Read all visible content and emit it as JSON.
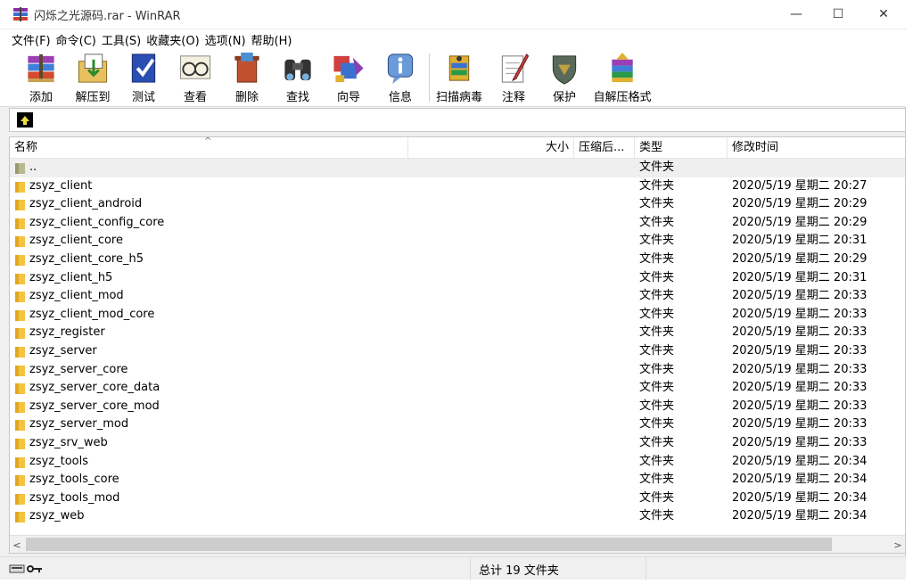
{
  "window": {
    "title": "闪烁之光源码.rar - WinRAR",
    "minimize_glyph": "—",
    "maximize_glyph": "☐",
    "close_glyph": "✕"
  },
  "menu": [
    {
      "label": "文件(F)"
    },
    {
      "label": "命令(C)"
    },
    {
      "label": "工具(S)"
    },
    {
      "label": "收藏夹(O)"
    },
    {
      "label": "选项(N)"
    },
    {
      "label": "帮助(H)"
    }
  ],
  "toolbar": [
    {
      "label": "添加",
      "icon": "add-icon"
    },
    {
      "label": "解压到",
      "icon": "extract-to-icon"
    },
    {
      "label": "测试",
      "icon": "test-icon"
    },
    {
      "label": "查看",
      "icon": "view-icon"
    },
    {
      "label": "删除",
      "icon": "delete-icon"
    },
    {
      "label": "查找",
      "icon": "find-icon"
    },
    {
      "label": "向导",
      "icon": "wizard-icon"
    },
    {
      "label": "信息",
      "icon": "info-icon"
    },
    {
      "label": "扫描病毒",
      "icon": "virus-scan-icon"
    },
    {
      "label": "注释",
      "icon": "comment-icon"
    },
    {
      "label": "保护",
      "icon": "protect-icon"
    },
    {
      "label": "自解压格式",
      "icon": "sfx-icon"
    }
  ],
  "columns": {
    "name": "名称",
    "size": "大小",
    "packed": "压缩后...",
    "type": "类型",
    "modified": "修改时间",
    "sort_arrow": "^"
  },
  "rows": [
    {
      "name": "..",
      "type": "文件夹",
      "modified": ""
    },
    {
      "name": "zsyz_client",
      "type": "文件夹",
      "modified": "2020/5/19 星期二 20:27"
    },
    {
      "name": "zsyz_client_android",
      "type": "文件夹",
      "modified": "2020/5/19 星期二 20:29"
    },
    {
      "name": "zsyz_client_config_core",
      "type": "文件夹",
      "modified": "2020/5/19 星期二 20:29"
    },
    {
      "name": "zsyz_client_core",
      "type": "文件夹",
      "modified": "2020/5/19 星期二 20:31"
    },
    {
      "name": "zsyz_client_core_h5",
      "type": "文件夹",
      "modified": "2020/5/19 星期二 20:29"
    },
    {
      "name": "zsyz_client_h5",
      "type": "文件夹",
      "modified": "2020/5/19 星期二 20:31"
    },
    {
      "name": "zsyz_client_mod",
      "type": "文件夹",
      "modified": "2020/5/19 星期二 20:33"
    },
    {
      "name": "zsyz_client_mod_core",
      "type": "文件夹",
      "modified": "2020/5/19 星期二 20:33"
    },
    {
      "name": "zsyz_register",
      "type": "文件夹",
      "modified": "2020/5/19 星期二 20:33"
    },
    {
      "name": "zsyz_server",
      "type": "文件夹",
      "modified": "2020/5/19 星期二 20:33"
    },
    {
      "name": "zsyz_server_core",
      "type": "文件夹",
      "modified": "2020/5/19 星期二 20:33"
    },
    {
      "name": "zsyz_server_core_data",
      "type": "文件夹",
      "modified": "2020/5/19 星期二 20:33"
    },
    {
      "name": "zsyz_server_core_mod",
      "type": "文件夹",
      "modified": "2020/5/19 星期二 20:33"
    },
    {
      "name": "zsyz_server_mod",
      "type": "文件夹",
      "modified": "2020/5/19 星期二 20:33"
    },
    {
      "name": "zsyz_srv_web",
      "type": "文件夹",
      "modified": "2020/5/19 星期二 20:33"
    },
    {
      "name": "zsyz_tools",
      "type": "文件夹",
      "modified": "2020/5/19 星期二 20:34"
    },
    {
      "name": "zsyz_tools_core",
      "type": "文件夹",
      "modified": "2020/5/19 星期二 20:34"
    },
    {
      "name": "zsyz_tools_mod",
      "type": "文件夹",
      "modified": "2020/5/19 星期二 20:34"
    },
    {
      "name": "zsyz_web",
      "type": "文件夹",
      "modified": "2020/5/19 星期二 20:34"
    }
  ],
  "status": {
    "summary": "总计 19 文件夹"
  },
  "scrollbar": {
    "left_glyph": "<",
    "right_glyph": ">"
  },
  "colors": {
    "folder": "#f5c242",
    "parent_folder": "#b8b890"
  }
}
